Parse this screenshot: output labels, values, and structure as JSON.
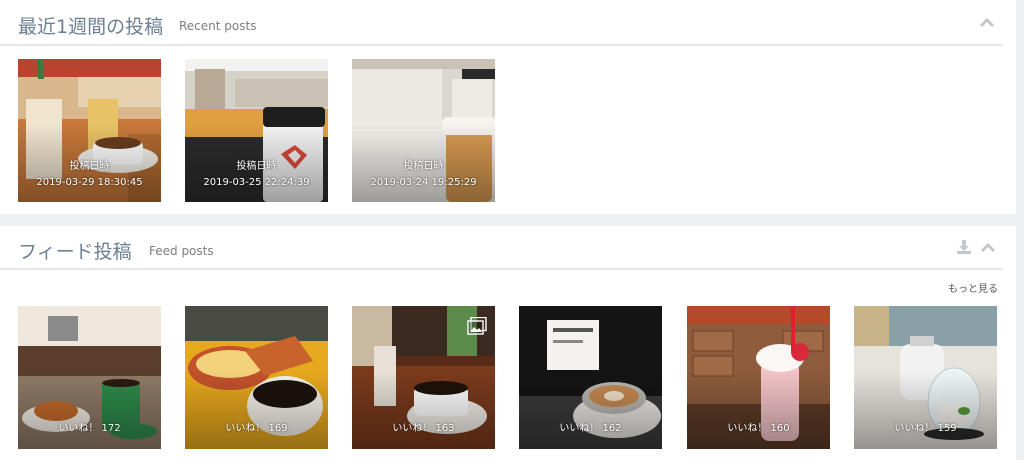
{
  "recent": {
    "title": "最近1週間の投稿",
    "subtitle": "Recent posts",
    "collapse_icon": "chevron-up-icon",
    "posts": [
      {
        "label": "投稿日時",
        "date": "2019-03-29 18:30:45"
      },
      {
        "label": "投稿日時",
        "date": "2019-03-25 22:24:39"
      },
      {
        "label": "投稿日時",
        "date": "2019-03-24 19:25:29"
      }
    ]
  },
  "feed": {
    "title": "フィード投稿",
    "subtitle": "Feed posts",
    "download_icon": "download-icon",
    "collapse_icon": "chevron-up-icon",
    "more_label": "もっと見る",
    "posts": [
      {
        "likes": "いいね！ 172"
      },
      {
        "likes": "いいね！ 169"
      },
      {
        "likes": "いいね！ 163",
        "icon": "multiple-images-icon"
      },
      {
        "likes": "いいね！ 162"
      },
      {
        "likes": "いいね！ 160"
      },
      {
        "likes": "いいね！ 159"
      }
    ]
  },
  "colors": {
    "title": "#6f7f94",
    "divider": "#e4e7ea",
    "background": "#eef0f2"
  }
}
